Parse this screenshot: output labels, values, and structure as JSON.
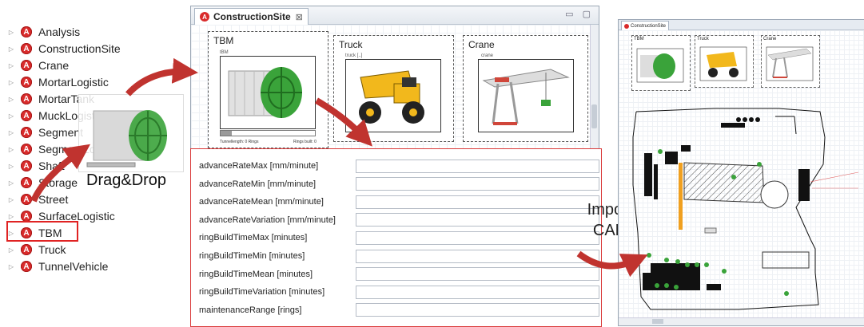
{
  "tree": {
    "items": [
      {
        "label": "Analysis"
      },
      {
        "label": "ConstructionSite"
      },
      {
        "label": "Crane"
      },
      {
        "label": "MortarLogistic"
      },
      {
        "label": "MortarTank"
      },
      {
        "label": "MuckLogistic"
      },
      {
        "label": "Segment"
      },
      {
        "label": "SegmentLogistic"
      },
      {
        "label": "Shaft"
      },
      {
        "label": "Storage"
      },
      {
        "label": "Street"
      },
      {
        "label": "SurfaceLogistic"
      },
      {
        "label": "TBM"
      },
      {
        "label": "Truck"
      },
      {
        "label": "TunnelVehicle"
      }
    ],
    "selected": "TBM",
    "icon_letter": "A"
  },
  "drag_label": "Drag&Drop",
  "import_label": "Import CAD",
  "window": {
    "tab_title": "ConstructionSite",
    "tab_close": "⊠",
    "controls": "▭ ▢",
    "cards": {
      "tbm": {
        "title": "TBM",
        "sub": "tBM",
        "left_text": "Tunnellength: 0 Rings",
        "right_text": "Rings built: 0"
      },
      "truck": {
        "title": "Truck",
        "sub": "truck [..]"
      },
      "crane": {
        "title": "Crane",
        "sub": "crane"
      }
    }
  },
  "properties": [
    {
      "label": "advanceRateMax [mm/minute]"
    },
    {
      "label": "advanceRateMin [mm/minute]"
    },
    {
      "label": "advanceRateMean [mm/minute]"
    },
    {
      "label": "advanceRateVariation [mm/minute]"
    },
    {
      "label": "ringBuildTimeMax [minutes]"
    },
    {
      "label": "ringBuildTimeMin [minutes]"
    },
    {
      "label": "ringBuildTimeMean [minutes]"
    },
    {
      "label": "ringBuildTimeVariation [minutes]"
    },
    {
      "label": "maintenanceRange [rings]"
    }
  ],
  "preview": {
    "tab_title": "ConstructionSite",
    "cards": {
      "tbm": "TBM",
      "truck": "Truck",
      "crane": "Crane"
    }
  },
  "colors": {
    "accent_red": "#d93a3a",
    "arrow_red": "#c0332f",
    "tbm_green": "#3aa33a",
    "truck_yellow": "#f2b81c",
    "crane_red": "#d0463a"
  },
  "icons": [
    "expander-triangle-icon",
    "element-a-icon",
    "close-icon",
    "minimize-icon",
    "maximize-icon"
  ]
}
